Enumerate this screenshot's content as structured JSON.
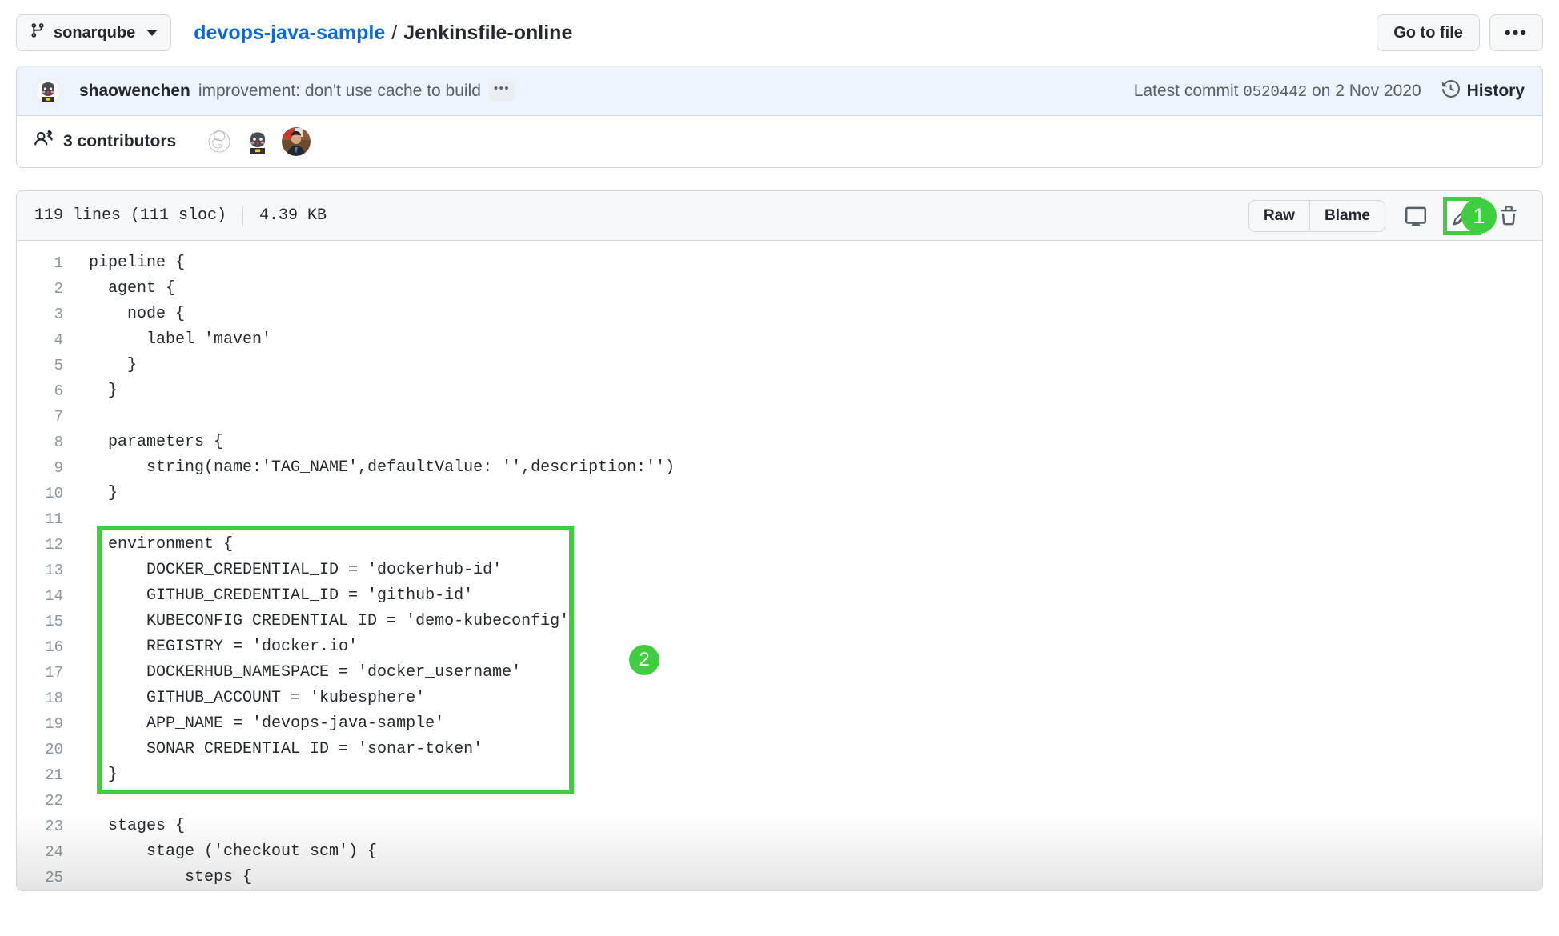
{
  "header": {
    "branch_selector": {
      "label": "sonarqube",
      "icon": "git-branch-icon",
      "caret": "chevron-down-icon"
    },
    "breadcrumb": {
      "repo": "devops-java-sample",
      "separator": "/",
      "file": "Jenkinsfile-online"
    },
    "go_to_file_label": "Go to file",
    "kebab_label": "•••"
  },
  "commit": {
    "author": "shaowenchen",
    "message": "improvement: don't use cache to build",
    "expand_label": "•••",
    "latest_commit_prefix": "Latest commit",
    "sha": "0520442",
    "date_prefix": "on",
    "date": "2 Nov 2020",
    "history_label": "History"
  },
  "contributors": {
    "count_label": "3 contributors",
    "icon": "people-icon",
    "avatars": [
      "contributor-avatar-1",
      "contributor-avatar-2",
      "contributor-avatar-3"
    ]
  },
  "file_toolbar": {
    "lines_label": "119 lines (111 sloc)",
    "size_label": "4.39 KB",
    "raw_label": "Raw",
    "blame_label": "Blame",
    "open_desktop_icon": "desktop-download-icon",
    "edit_icon": "pencil-icon",
    "delete_icon": "trash-icon"
  },
  "annotations": {
    "badge_edit": "1",
    "badge_environment": "2",
    "highlight_color": "#3fce3f"
  },
  "code": {
    "language": "groovy",
    "start_line": 1,
    "lines": [
      "pipeline {",
      "  agent {",
      "    node {",
      "      label 'maven'",
      "    }",
      "  }",
      "",
      "  parameters {",
      "      string(name:'TAG_NAME',defaultValue: '',description:'')",
      "  }",
      "",
      "  environment {",
      "      DOCKER_CREDENTIAL_ID = 'dockerhub-id'",
      "      GITHUB_CREDENTIAL_ID = 'github-id'",
      "      KUBECONFIG_CREDENTIAL_ID = 'demo-kubeconfig'",
      "      REGISTRY = 'docker.io'",
      "      DOCKERHUB_NAMESPACE = 'docker_username'",
      "      GITHUB_ACCOUNT = 'kubesphere'",
      "      APP_NAME = 'devops-java-sample'",
      "      SONAR_CREDENTIAL_ID = 'sonar-token'",
      "  }",
      "",
      "  stages {",
      "      stage ('checkout scm') {",
      "          steps {"
    ]
  }
}
